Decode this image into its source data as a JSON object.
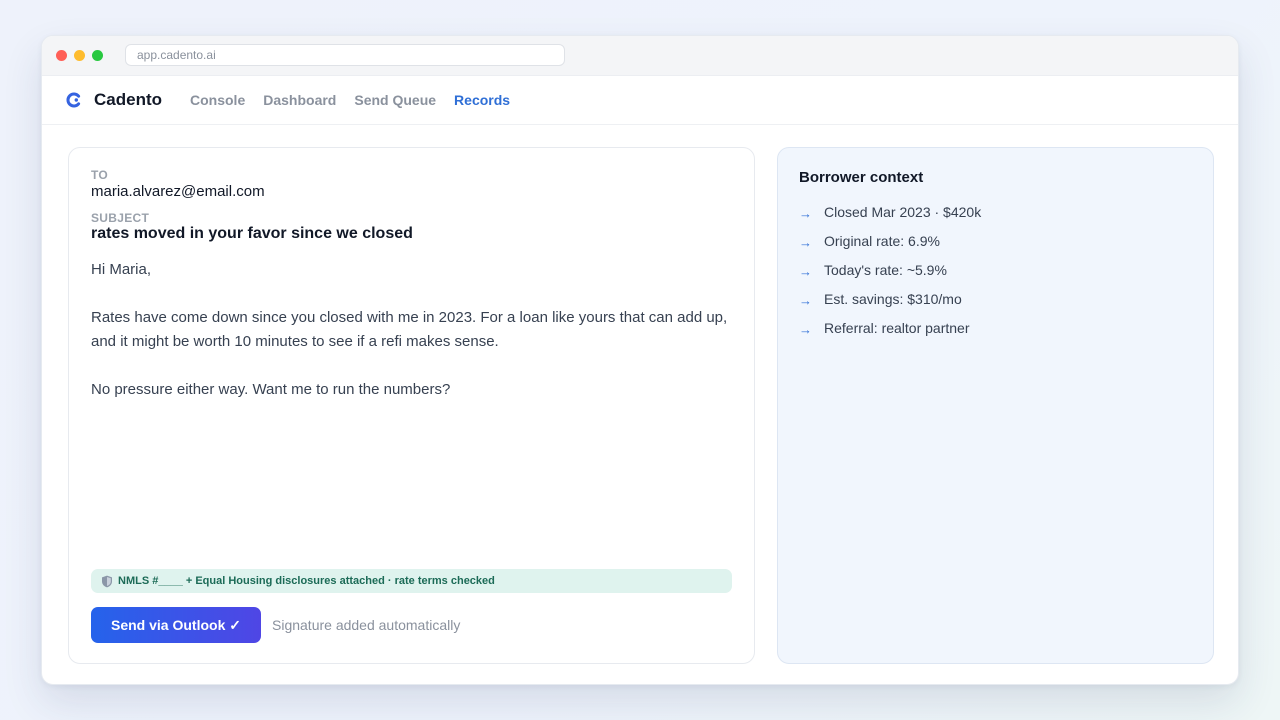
{
  "browser": {
    "url": "app.cadento.ai"
  },
  "nav": {
    "brand": "Cadento",
    "links": [
      {
        "label": "Console",
        "active": false
      },
      {
        "label": "Dashboard",
        "active": false
      },
      {
        "label": "Send Queue",
        "active": false
      },
      {
        "label": "Records",
        "active": true
      }
    ]
  },
  "email": {
    "to_label": "TO",
    "to": "maria.alvarez@email.com",
    "subject_label": "SUBJECT",
    "subject": "rates moved in your favor since we closed",
    "greeting": "Hi Maria,",
    "paragraph1": "Rates have come down since you closed with me in 2023. For a loan like yours that can add up, and it might be worth 10 minutes to see if a refi makes sense.",
    "paragraph2": "No pressure either way. Want me to run the numbers?",
    "compliance": "NMLS #____ + Equal Housing disclosures attached · rate terms checked",
    "send_label": "Send via Outlook ✓",
    "signature_note": "Signature added automatically"
  },
  "context": {
    "title": "Borrower context",
    "items": [
      "Closed Mar 2023 · $420k",
      "Original rate: 6.9%",
      "Today's rate: ~5.9%",
      "Est. savings: $310/mo",
      "Referral: realtor partner"
    ]
  },
  "colors": {
    "accent": "#2f6fd6",
    "button_start": "#2563eb",
    "button_end": "#4f46e5",
    "compliance_bg": "#dff3ee",
    "compliance_text": "#1c6b57"
  },
  "icons": {
    "logo": "cadento-logo-icon",
    "compliance": "shield-icon",
    "context_bullet": "arrow-right-icon"
  }
}
